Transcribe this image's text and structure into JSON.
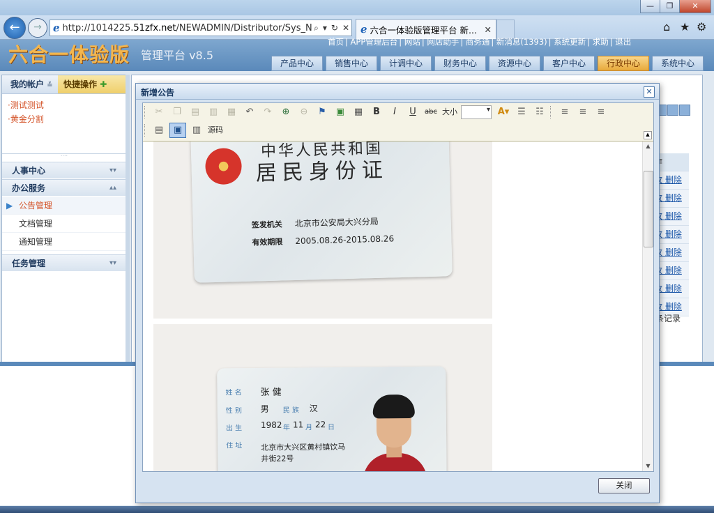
{
  "browser": {
    "url_prefix": "http://1014225.",
    "url_domain": "51zfx.net",
    "url_path": "/NEWADMIN/Distributor/Sys_New",
    "tab_title": "六合一体验版管理平台 新..."
  },
  "app": {
    "logo": "六合一体验版",
    "version": "管理平台 v8.5",
    "top_links": [
      "首页",
      "APP管理后台",
      "网站",
      "网店助手",
      "商务通",
      "新消息(1393)",
      "系统更新",
      "求助",
      "退出"
    ],
    "nav": [
      "产品中心",
      "销售中心",
      "计调中心",
      "财务中心",
      "资源中心",
      "客户中心",
      "行政中心",
      "系统中心"
    ],
    "nav_active": "行政中心"
  },
  "sidebar": {
    "tab_account": "我的帐户",
    "tab_quick": "快捷操作",
    "quick_links": [
      "测试测试",
      "黄金分割"
    ],
    "sections": [
      {
        "label": "人事中心"
      },
      {
        "label": "办公服务"
      },
      {
        "label": "任务管理"
      }
    ],
    "items": [
      "公告管理",
      "文档管理",
      "通知管理"
    ]
  },
  "background_table": {
    "header": "作",
    "row_actions": [
      "改 删除",
      "改 删除",
      "改 删除",
      "改 删除",
      "改 删除",
      "改 删除",
      "改 删除",
      "改 删除"
    ],
    "footer": "条记录"
  },
  "modal": {
    "title": "新增公告",
    "toolbar_size_label": "大小",
    "toolbar_source_label": "源码",
    "close_button": "关闭"
  },
  "idcard_back": {
    "title_top": "中华人民共和国",
    "title": "居民身份证",
    "issuer_label": "签发机关",
    "issuer": "北京市公安局大兴分局",
    "valid_label": "有效期限",
    "valid": "2005.08.26-2015.08.26"
  },
  "idcard_front": {
    "name_label": "姓 名",
    "name": "张 健",
    "sex_label": "性 别",
    "sex": "男",
    "ethnic_label": "民 族",
    "ethnic": "汉",
    "birth_label": "出 生",
    "birth_year": "1982",
    "birth_year_unit": "年",
    "birth_month": "11",
    "birth_month_unit": "月",
    "birth_day": "22",
    "birth_day_unit": "日",
    "addr_label": "住 址",
    "addr_line1": "北京市大兴区黄村镇饮马",
    "addr_line2": "井街22号"
  }
}
